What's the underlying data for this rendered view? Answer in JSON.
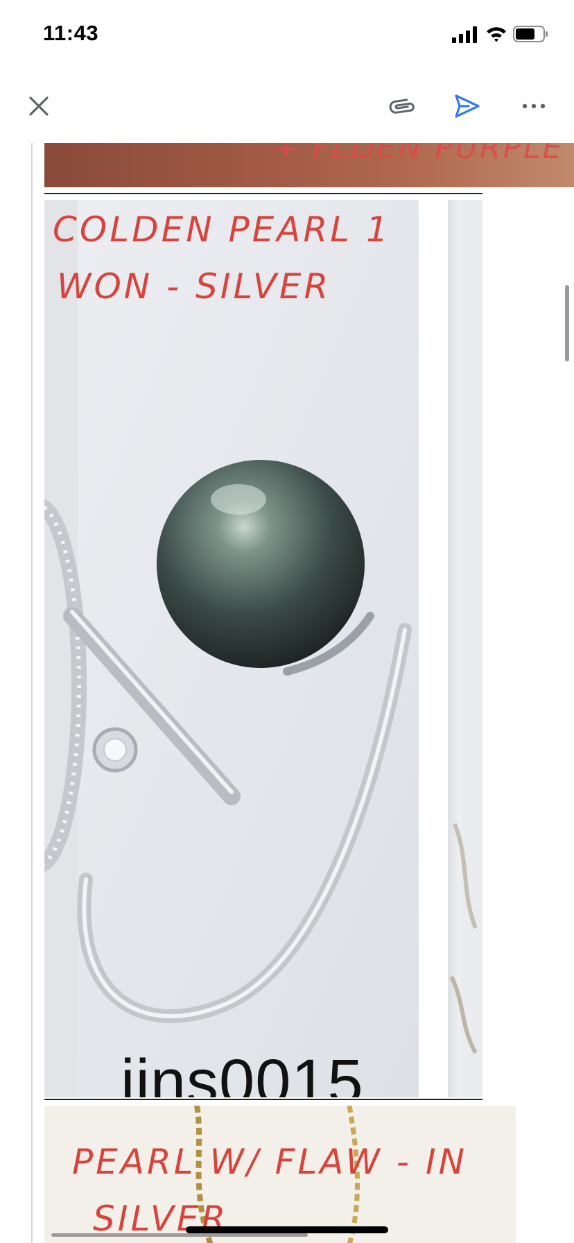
{
  "status_bar": {
    "time": "11:43",
    "icons": [
      "signal-icon",
      "wifi-icon",
      "battery-icon"
    ]
  },
  "toolbar": {
    "icons": [
      "close-icon",
      "attachment-icon",
      "send-icon",
      "more-icon"
    ],
    "accent_color": "#3478f6"
  },
  "images": [
    {
      "handwritten_text": "+ FLDEN PURPLE - SILVER"
    },
    {
      "handwritten_lines": [
        "COLDEN PEARL 1",
        "WON - SILVER"
      ],
      "product_code": "jins0015"
    },
    {
      "handwritten_text": "PEARL W/ FLAW - IN",
      "handwritten_text_2": "SILVER"
    }
  ],
  "colors": {
    "handwriting": "#d8443c",
    "scrollbar": "#9a9a9a"
  }
}
